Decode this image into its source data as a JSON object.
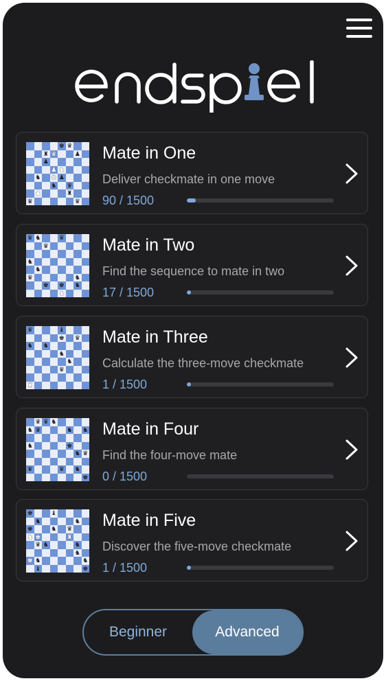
{
  "app": {
    "logo_text": "endspiel"
  },
  "colors": {
    "background": "#1c1c1e",
    "accent": "#7fa8d8",
    "toggle_active": "#5b7d9d",
    "board_light": "#e9eef7",
    "board_dark": "#6f93d6"
  },
  "icons": {
    "menu": "hamburger-menu-icon",
    "chevron": "chevron-right-icon"
  },
  "puzzles": [
    {
      "title": "Mate in One",
      "description": "Deliver checkmate in one move",
      "progress_text": "90 / 1500",
      "progress": 0.06
    },
    {
      "title": "Mate in Two",
      "description": "Find the sequence to mate in two",
      "progress_text": "17 / 1500",
      "progress": 0.011
    },
    {
      "title": "Mate in Three",
      "description": "Calculate the three-move checkmate",
      "progress_text": "1 / 1500",
      "progress": 0.0007
    },
    {
      "title": "Mate in Four",
      "description": "Find the four-move mate",
      "progress_text": "0 / 1500",
      "progress": 0
    },
    {
      "title": "Mate in Five",
      "description": "Discover the five-move checkmate",
      "progress_text": "1 / 1500",
      "progress": 0.0007
    }
  ],
  "level_toggle": {
    "options": [
      "Beginner",
      "Advanced"
    ],
    "selected": "Advanced"
  }
}
